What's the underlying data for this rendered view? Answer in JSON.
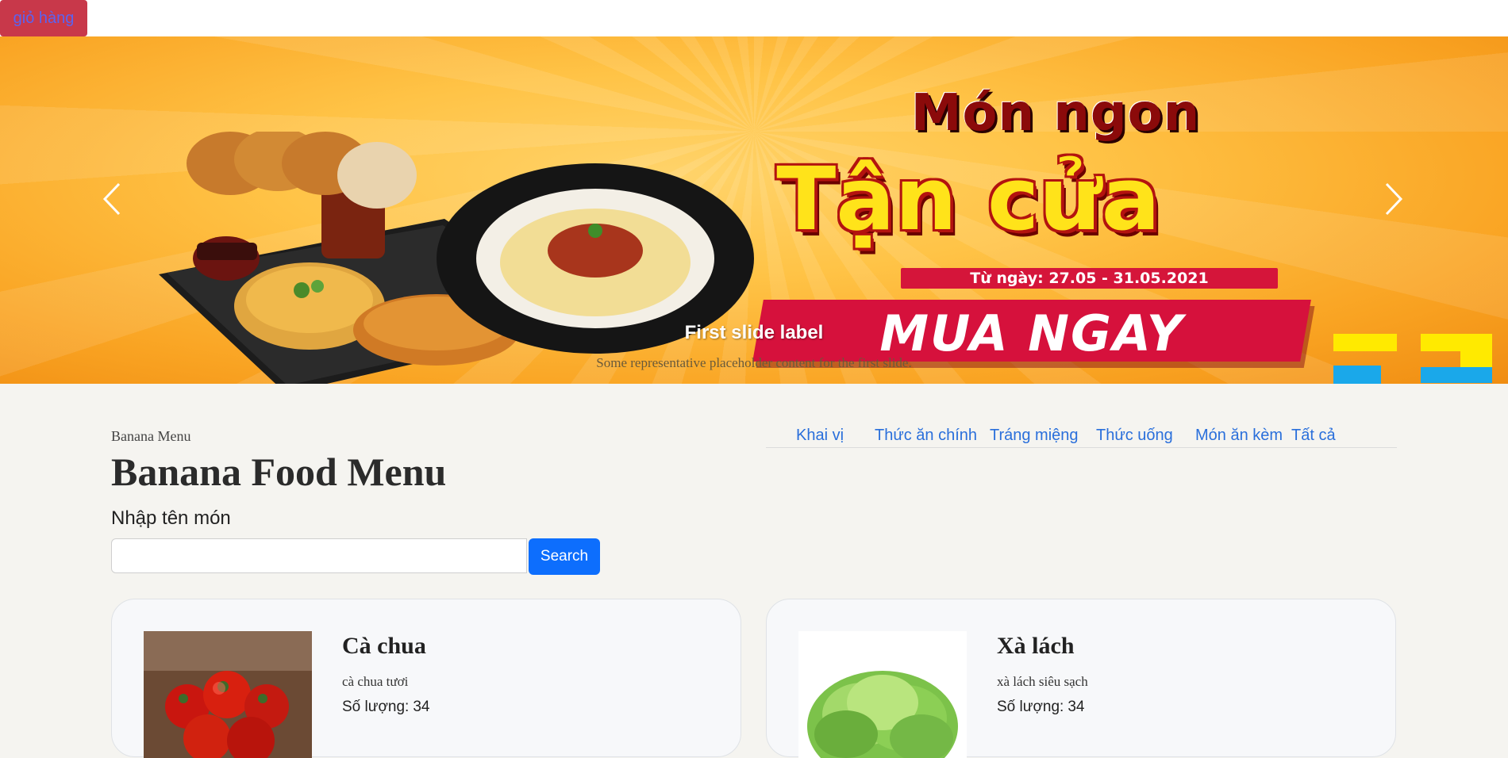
{
  "header": {
    "cart_label": "giỏ hàng"
  },
  "carousel": {
    "banner_line1": "Món ngon",
    "banner_line2": "Tận cửa",
    "banner_date": "Từ ngày: 27.05 - 31.05.2021",
    "banner_cta": "MUA NGAY",
    "caption_title": "First slide label",
    "caption_text": "Some representative placeholder content for the first slide.",
    "slide_count": 3,
    "active_slide": 1,
    "icons": {
      "prev": "chevron-left-icon",
      "next": "chevron-right-icon"
    }
  },
  "menu": {
    "breadcrumb": "Banana Menu",
    "title": "Banana Food Menu",
    "categories": [
      "Khai vị",
      "Thức ăn chính",
      "Tráng miệng",
      "Thức uống",
      "Món ăn kèm",
      "Tất cả"
    ]
  },
  "search": {
    "label": "Nhập tên món",
    "value": "",
    "button_label": "Search"
  },
  "products": [
    {
      "name": "Cà chua",
      "description": "cà chua tươi",
      "qty_label": "Số lượng:",
      "qty": "34"
    },
    {
      "name": "Xà lách",
      "description": "xà lách siêu sạch",
      "qty_label": "Số lượng:",
      "qty": "34"
    }
  ],
  "colors": {
    "cart_bg": "#c8384a",
    "cart_text": "#5b63f0",
    "link": "#2a6fdb",
    "primary_button": "#0d6efd",
    "page_bg": "#f5f4f0"
  }
}
